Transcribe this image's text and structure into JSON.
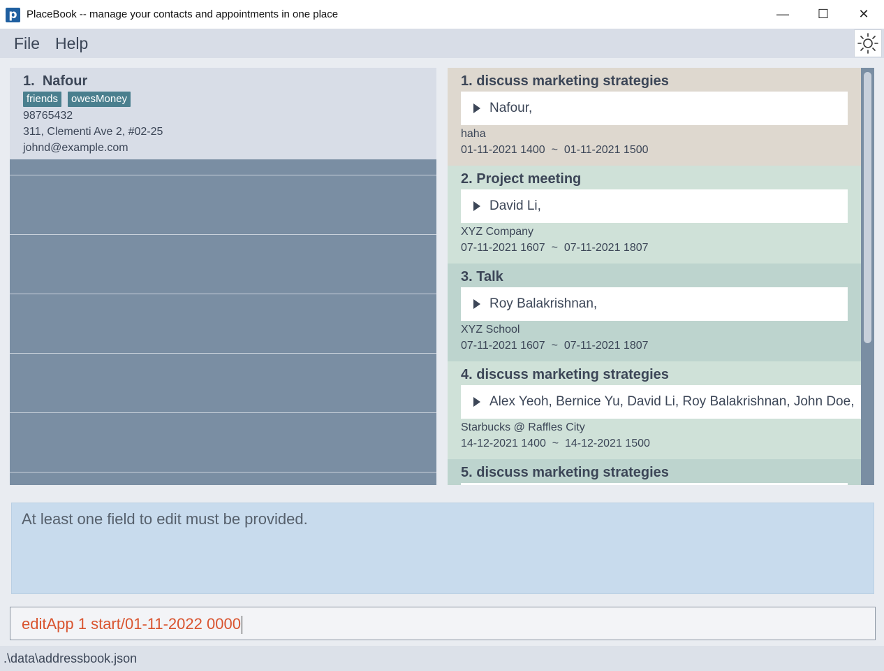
{
  "window": {
    "title": "PlaceBook -- manage your contacts and appointments in one place",
    "app_icon_letter": "p",
    "minimize_glyph": "—",
    "maximize_glyph": "☐",
    "close_glyph": "✕"
  },
  "menu": {
    "items": [
      "File",
      "Help"
    ],
    "theme_icon": "sun-icon"
  },
  "persons": [
    {
      "index": "1.",
      "name": "Nafour",
      "tags": [
        "friends",
        "owesMoney"
      ],
      "phone": "98765432",
      "address": "311, Clementi Ave 2, #02-25",
      "email": "johnd@example.com"
    }
  ],
  "appointments": [
    {
      "title": "1.  discuss marketing strategies",
      "attendees": "Nafour,",
      "location": "haha",
      "time": "01-11-2021 1400  ~  01-11-2021 1500",
      "color": "#ded8cf"
    },
    {
      "title": "2.  Project meeting",
      "attendees": "David Li,",
      "location": "XYZ Company",
      "time": "07-11-2021 1607  ~  07-11-2021 1807",
      "color": "#cfe1d8"
    },
    {
      "title": "3.  Talk",
      "attendees": "Roy Balakrishnan,",
      "location": "XYZ School",
      "time": "07-11-2021 1607  ~  07-11-2021 1807",
      "color": "#bdd4ce"
    },
    {
      "title": "4.  discuss marketing strategies",
      "attendees": "Alex Yeoh, Bernice Yu, David Li, Roy Balakrishnan, John Doe,",
      "location": "Starbucks @ Raffles City",
      "time": "14-12-2021 1400  ~  14-12-2021 1500",
      "color": "#cfe1d8"
    },
    {
      "title": "5.  discuss marketing strategies",
      "attendees": "",
      "location": "",
      "time": "",
      "color": "#bdd4ce"
    }
  ],
  "result": {
    "message": "At least one field to edit must be provided."
  },
  "command": {
    "value": "editApp 1 start/01-11-2022 0000"
  },
  "status": {
    "file_path": ".\\data\\addressbook.json"
  }
}
